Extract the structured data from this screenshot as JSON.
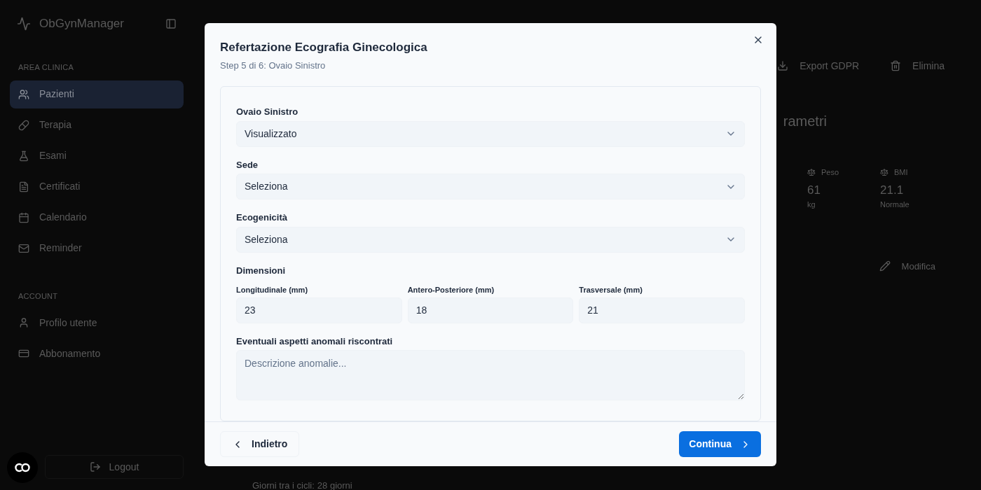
{
  "sidebar": {
    "brand": "ObGynManager",
    "sections": [
      {
        "title": "AREA CLINICA",
        "items": [
          {
            "label": "Pazienti",
            "selected": true
          },
          {
            "label": "Terapia",
            "selected": false
          },
          {
            "label": "Esami",
            "selected": false
          },
          {
            "label": "Certificati",
            "selected": false
          },
          {
            "label": "Calendario",
            "selected": false
          },
          {
            "label": "Reminder",
            "selected": false
          }
        ]
      },
      {
        "title": "ACCOUNT",
        "items": [
          {
            "label": "Profilo utente",
            "selected": false
          },
          {
            "label": "Abbonamento",
            "selected": false
          }
        ]
      }
    ],
    "logout": "Logout"
  },
  "header_actions": [
    "Export GDPR",
    "Elimina"
  ],
  "background_content": {
    "heading": "rametri",
    "stats": [
      {
        "label": "Peso",
        "value": "61",
        "note": "kg"
      },
      {
        "label": "BMI",
        "value": "21.1",
        "note": "Normale"
      }
    ],
    "edit_button": "Modifica",
    "cycle_label": "Giorni tra i cicli:",
    "cycle_value": "28 giorni"
  },
  "dialog": {
    "title": "Refertazione Ecografia Ginecologica",
    "subtitle": "Step 5 di 6: Ovaio Sinistro",
    "fields": [
      {
        "kind": "select",
        "label": "Ovaio Sinistro",
        "value": "Visualizzato"
      },
      {
        "kind": "select",
        "label": "Sede",
        "value": "Seleziona"
      },
      {
        "kind": "select",
        "label": "Ecogenicità",
        "value": "Seleziona"
      },
      {
        "kind": "dimensions",
        "label": "Dimensioni",
        "inputs": [
          {
            "label": "Longitudinale (mm)",
            "value": "23"
          },
          {
            "label": "Antero-Posteriore (mm)",
            "value": "18"
          },
          {
            "label": "Trasversale (mm)",
            "value": "21"
          }
        ]
      },
      {
        "kind": "textarea",
        "label": "Eventuali aspetti anomali riscontrati",
        "placeholder": "Descrizione anomalie..."
      }
    ],
    "back_button": "Indietro",
    "continue_button": "Continua"
  }
}
